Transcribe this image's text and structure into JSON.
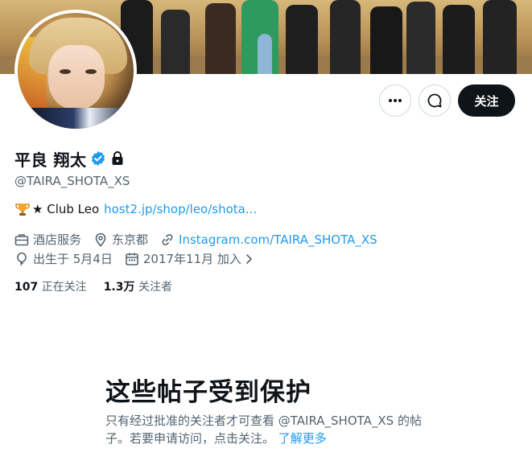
{
  "profile": {
    "display_name": "平良 翔太",
    "handle": "@TAIRA_SHOTA_XS",
    "bio_prefix": "★ Club Leo",
    "bio_link": "host2.jp/shop/leo/shota...",
    "category": "酒店服务",
    "location": "东京都",
    "website": "Instagram.com/TAIRA_SHOTA_XS",
    "birthday": "出生于 5月4日",
    "joined": "2017年11月 加入"
  },
  "stats": {
    "following_count": "107",
    "following_label": "正在关注",
    "followers_count": "1.3万",
    "followers_label": "关注者"
  },
  "actions": {
    "follow_label": "关注"
  },
  "protected": {
    "title": "这些帖子受到保护",
    "description": "只有经过批准的关注者才可查看 @TAIRA_SHOTA_XS 的帖子。若要申请访问，点击关注。",
    "learn_more": "了解更多"
  },
  "icons": {
    "verified": "verified-badge-icon",
    "lock": "lock-icon",
    "trophy": "trophy-icon",
    "briefcase": "briefcase-icon",
    "location": "location-pin-icon",
    "link": "link-icon",
    "balloon": "balloon-icon",
    "calendar": "calendar-icon",
    "more": "more-dots-icon",
    "message": "message-icon"
  },
  "colors": {
    "accent": "#1d9bf0",
    "text_primary": "#0f1419",
    "text_secondary": "#536471",
    "follow_button_bg": "#0f1419"
  }
}
